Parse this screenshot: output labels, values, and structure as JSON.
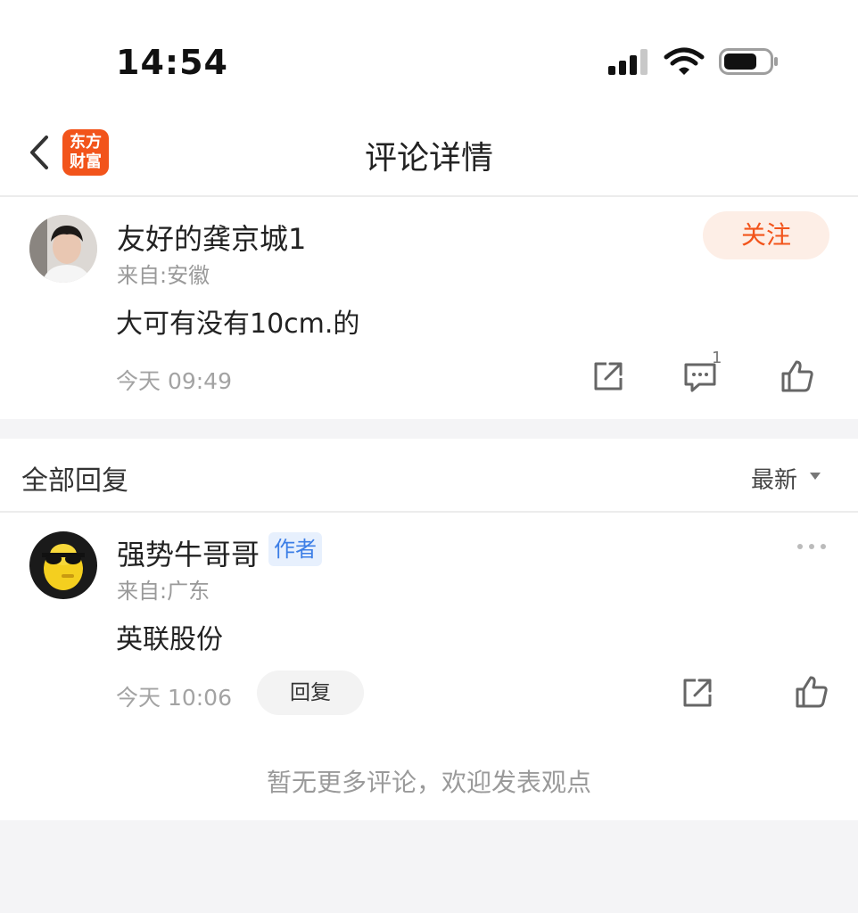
{
  "status_bar": {
    "time": "14:54"
  },
  "nav": {
    "title": "评论详情",
    "logo_line1": "东方",
    "logo_line2": "财富",
    "back_icon": "chevron-left-icon"
  },
  "main_comment": {
    "user_name": "友好的龚京城1",
    "location": "来自:安徽",
    "text": "大可有没有10cm.的",
    "time": "今天 09:49",
    "follow_label": "关注",
    "comment_count": "1"
  },
  "replies_section": {
    "title": "全部回复",
    "sort_label": "最新"
  },
  "replies": [
    {
      "user_name": "强势牛哥哥",
      "badge": "作者",
      "location": "来自:广东",
      "text": "英联股份",
      "time": "今天 10:06",
      "reply_label": "回复"
    }
  ],
  "footer": {
    "message": "暂无更多评论，欢迎发表观点"
  },
  "colors": {
    "accent": "#f2541b",
    "badge_blue": "#3c7ee6",
    "background": "#f4f4f6"
  }
}
